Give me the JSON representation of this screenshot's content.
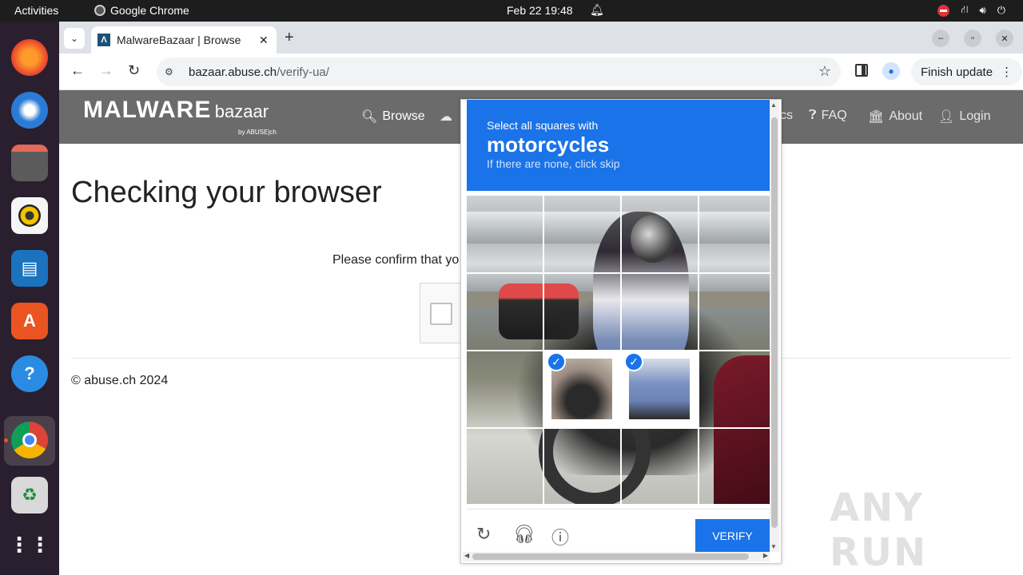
{
  "topbar": {
    "activities": "Activities",
    "app_name": "Google Chrome",
    "clock": "Feb 22  19:48"
  },
  "dock": {
    "items": [
      "firefox-icon",
      "thunderbird-icon",
      "files-icon",
      "rhythmbox-icon",
      "writer-icon",
      "app-center-icon",
      "help-icon",
      "chrome-icon",
      "trash-icon",
      "app-grid-icon"
    ]
  },
  "browser": {
    "tab_title": "MalwareBazaar | Browse",
    "url_host": "bazaar.abuse.ch",
    "url_path": "/verify-ua/",
    "finish_update": "Finish update"
  },
  "site": {
    "logo_main": "MALWARE",
    "logo_sub": "bazaar",
    "logo_by": "by ABUSE|ch",
    "nav": [
      {
        "label": "Browse",
        "icon": "search-icon"
      },
      {
        "label": "FAQ",
        "icon": "question-icon"
      },
      {
        "label": "About",
        "icon": "building-icon"
      },
      {
        "label": "Login",
        "icon": "user-icon"
      }
    ],
    "nav_partial_left": "",
    "nav_partial_right": "cs",
    "heading": "Checking your browser",
    "confirm_text": "Please confirm that yo",
    "footer": "© abuse.ch 2024"
  },
  "captcha": {
    "instruction": "Select all squares with",
    "target": "motorcycles",
    "hint": "If there are none, click skip",
    "verify_label": "VERIFY",
    "selected_cells": [
      [
        2,
        1
      ],
      [
        2,
        2
      ]
    ]
  },
  "watermark": "ANY RUN"
}
